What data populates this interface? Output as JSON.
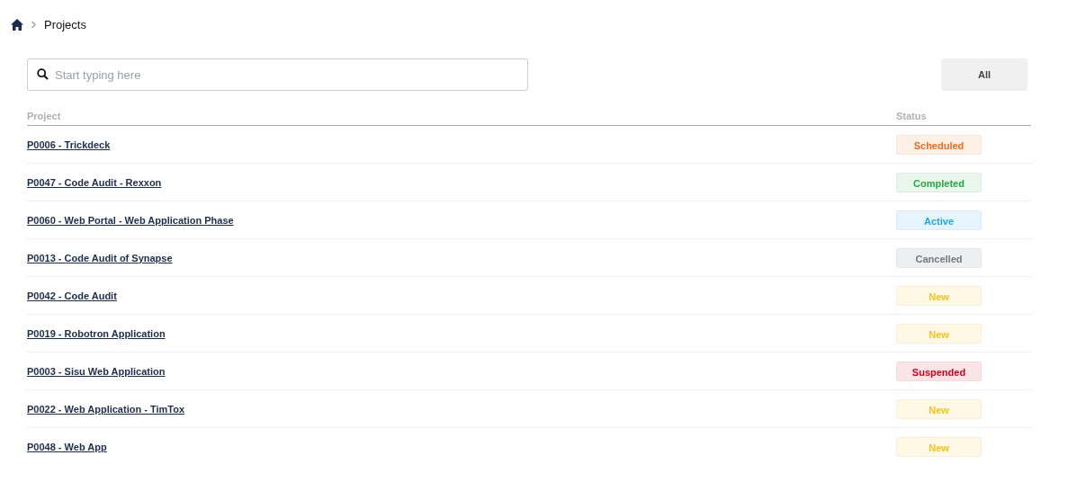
{
  "breadcrumb": {
    "current": "Projects"
  },
  "search": {
    "placeholder": "Start typing here"
  },
  "filter_button": "All",
  "table": {
    "columns": [
      "Project",
      "Status"
    ],
    "rows": [
      {
        "project": "P0006 - Trickdeck",
        "status": "Scheduled",
        "kind": "scheduled"
      },
      {
        "project": "P0047 - Code Audit - Rexxon",
        "status": "Completed",
        "kind": "completed"
      },
      {
        "project": "P0060 - Web Portal - Web Application Phase",
        "status": "Active",
        "kind": "active"
      },
      {
        "project": "P0013 - Code Audit of Synapse",
        "status": "Cancelled",
        "kind": "cancelled"
      },
      {
        "project": "P0042 - Code Audit",
        "status": "New",
        "kind": "new"
      },
      {
        "project": "P0019 - Robotron Application",
        "status": "New",
        "kind": "new"
      },
      {
        "project": "P0003 - Sisu Web Application",
        "status": "Suspended",
        "kind": "suspended"
      },
      {
        "project": "P0022 - Web Application - TimTox",
        "status": "New",
        "kind": "new"
      },
      {
        "project": "P0048 - Web App",
        "status": "New",
        "kind": "new"
      }
    ]
  }
}
